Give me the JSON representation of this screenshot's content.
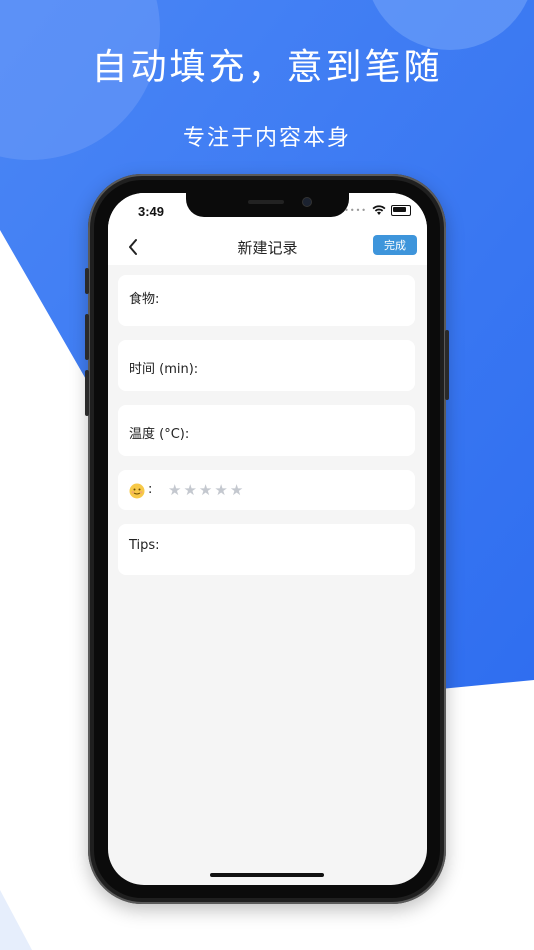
{
  "banner": {
    "headline": "自动填充，意到笔随",
    "subline": "专注于内容本身"
  },
  "status_bar": {
    "time": "3:49",
    "icons": [
      "signal-dots-icon",
      "wifi-icon",
      "battery-icon"
    ]
  },
  "nav": {
    "back_icon": "chevron-left-icon",
    "title": "新建记录",
    "done_label": "完成"
  },
  "form": {
    "food_label": "食物:",
    "food_value": "",
    "time_label": "时间 (min):",
    "time_value": "",
    "temp_label": "温度 (°C):",
    "temp_value": "",
    "rating_colon": ":",
    "rating_icon": "smiley-icon",
    "rating_value": 0,
    "rating_max": 5,
    "tips_label": "Tips:",
    "tips_value": ""
  },
  "colors": {
    "background_blue": "#3f7cf2",
    "accent_button": "#3e95db",
    "star_inactive": "#c4c8cf",
    "screen_bg": "#f5f5f5"
  }
}
